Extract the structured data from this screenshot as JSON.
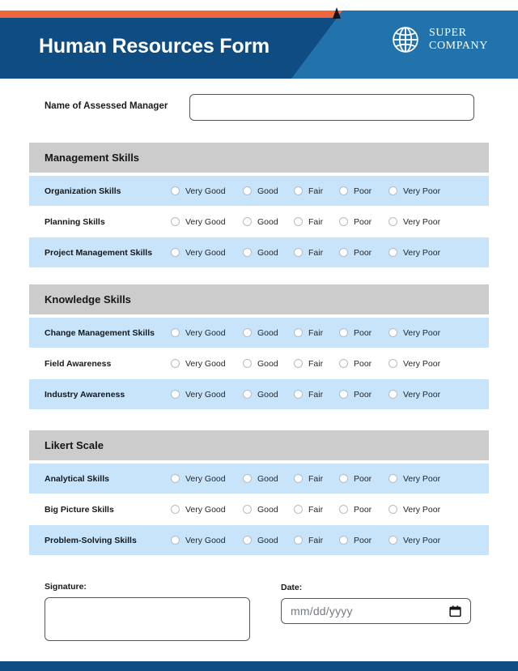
{
  "header": {
    "title": "Human Resources Form",
    "logo": {
      "icon": "globe-icon",
      "line1": "SUPER",
      "line2": "COMPANY"
    },
    "colors": {
      "accent_orange": "#f1663c",
      "dark_blue": "#0f4c81",
      "light_blue": "#2272ab",
      "notch": "#11161e"
    }
  },
  "name_field": {
    "label": "Name of Assessed Manager",
    "value": "",
    "placeholder": ""
  },
  "scale_options": [
    "Very Good",
    "Good",
    "Fair",
    "Poor",
    "Very Poor"
  ],
  "sections": [
    {
      "title": "Management Skills",
      "rows": [
        {
          "label": "Organization Skills",
          "selected": null
        },
        {
          "label": "Planning Skills",
          "selected": null
        },
        {
          "label": "Project Management Skills",
          "selected": null
        }
      ]
    },
    {
      "title": "Knowledge Skills",
      "rows": [
        {
          "label": "Change Management Skills",
          "selected": null
        },
        {
          "label": "Field Awareness",
          "selected": null
        },
        {
          "label": "Industry Awareness",
          "selected": null
        }
      ]
    },
    {
      "title": "Likert Scale",
      "rows": [
        {
          "label": "Analytical Skills",
          "selected": null
        },
        {
          "label": "Big Picture Skills",
          "selected": null
        },
        {
          "label": "Problem-Solving Skills",
          "selected": null
        }
      ]
    }
  ],
  "signature": {
    "label": "Signature:",
    "value": ""
  },
  "date": {
    "label": "Date:",
    "placeholder": "mm/dd/yyyy",
    "value": "",
    "icon": "calendar-icon"
  },
  "theme": {
    "section_header_bg": "#cccccc",
    "row_alt_bg": "#c7e4fb",
    "row_bg": "#ffffff"
  }
}
